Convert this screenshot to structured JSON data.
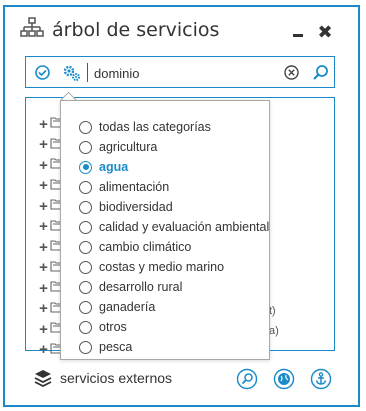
{
  "window": {
    "title": "árbol de servicios",
    "icons": {
      "title": "sitemap-icon",
      "minimize": "minimize-icon",
      "close": "close-icon"
    },
    "close_glyph": "✖"
  },
  "search": {
    "value": "dominio",
    "icons": {
      "filter": "check-circle-icon",
      "settings": "gears-icon",
      "clear": "clear-circle-icon",
      "search": "search-icon"
    }
  },
  "tree": {
    "suffixes": [
      "t)",
      "a)"
    ]
  },
  "dropdown": {
    "selected_index": 2,
    "options": [
      "todas las categorías",
      "agricultura",
      "agua",
      "alimentación",
      "biodiversidad",
      "calidad y evaluación ambiental",
      "cambio climático",
      "costas y medio marino",
      "desarrollo rural",
      "ganadería",
      "otros",
      "pesca"
    ]
  },
  "footer": {
    "label": "servicios externos",
    "icons": {
      "layers": "layers-icon",
      "search": "search-icon",
      "globe": "globe-icon",
      "anchor": "anchor-icon"
    }
  },
  "colors": {
    "accent": "#1a8bc8",
    "text": "#333333",
    "border": "#a8a8a8"
  }
}
